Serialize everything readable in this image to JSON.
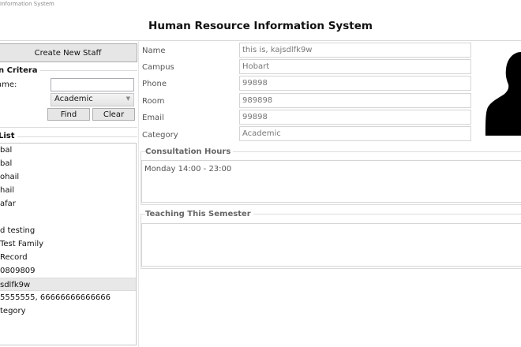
{
  "window": {
    "title": "Information System"
  },
  "header": {
    "title": "Human Resource Information System"
  },
  "left": {
    "create_label": "Create New Staff",
    "search_section": "n Critera",
    "name_label": "ame:",
    "name_value": "",
    "category_selected": "Academic",
    "find_label": "Find",
    "clear_label": "Clear",
    "list_section": "List",
    "items": [
      "bal",
      "bal",
      "ohail",
      "hail",
      "afar",
      "",
      "d testing",
      " Test Family",
      " Record",
      "0809809",
      "sdlfk9w",
      "5555555, 66666666666666",
      "tegory"
    ],
    "selected_index": 10
  },
  "detail": {
    "fields": [
      {
        "label": "Name",
        "value": "this is, kajsdlfk9w"
      },
      {
        "label": "Campus",
        "value": "Hobart"
      },
      {
        "label": "Phone",
        "value": "99898"
      },
      {
        "label": "Room",
        "value": "989898"
      },
      {
        "label": "Email",
        "value": "99898"
      },
      {
        "label": "Category",
        "value": "Academic"
      }
    ],
    "consultation_title": "Consultation Hours",
    "consultation_text": "Monday 14:00 - 23:00",
    "teaching_title": "Teaching This Semester",
    "teaching_text": ""
  },
  "colors": {
    "accent_border": "#adadad",
    "selected_row": "#e8e8e8"
  },
  "icons": {
    "photo": "person-silhouette-icon",
    "dropdown": "chevron-down-icon"
  }
}
